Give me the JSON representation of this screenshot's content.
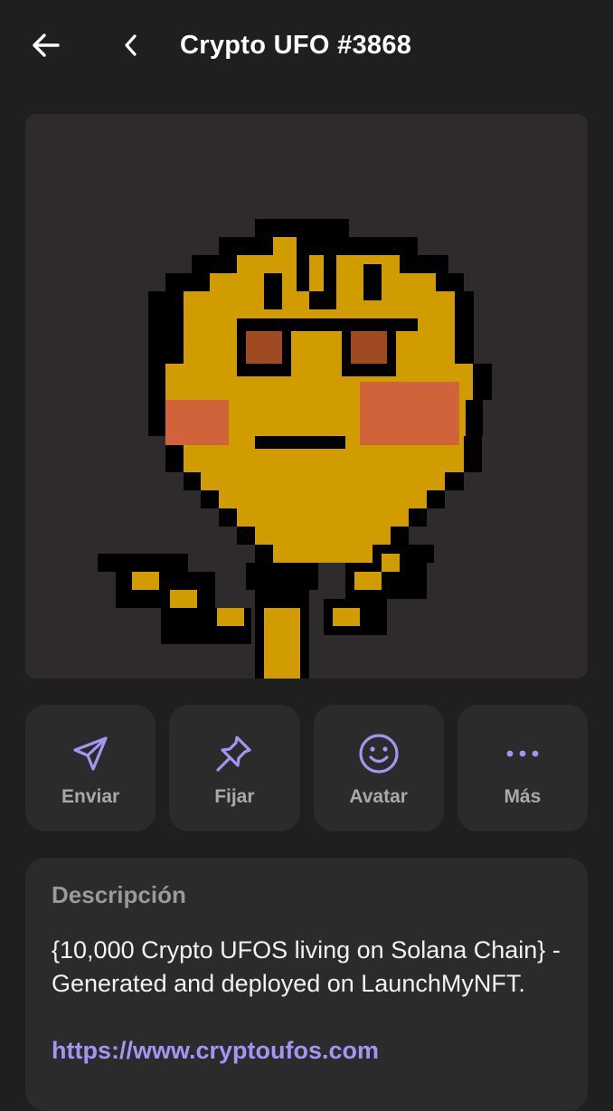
{
  "header": {
    "title": "Crypto UFO #3868",
    "back_icon": "arrow-left-icon",
    "nav_icon": "chevron-left-icon"
  },
  "nft": {
    "background_color": "#2f2a2b",
    "primary_color": "#d19c00",
    "cheek_color": "#d0633a",
    "eye_color": "#a04a24",
    "outline_color": "#000000"
  },
  "actions": [
    {
      "label": "Enviar",
      "icon": "send-icon"
    },
    {
      "label": "Fijar",
      "icon": "pin-icon"
    },
    {
      "label": "Avatar",
      "icon": "smiley-icon"
    },
    {
      "label": "Más",
      "icon": "more-dots-icon"
    }
  ],
  "description": {
    "heading": "Descripción",
    "text": "{10,000 Crypto UFOS living on Solana Chain} - Generated and deployed on LaunchMyNFT.",
    "link": "https://www.cryptoufos.com"
  },
  "colors": {
    "background": "#1f1f1f",
    "card": "#2b2b2b",
    "accent": "#a694f5",
    "label": "#a9a9a9"
  }
}
